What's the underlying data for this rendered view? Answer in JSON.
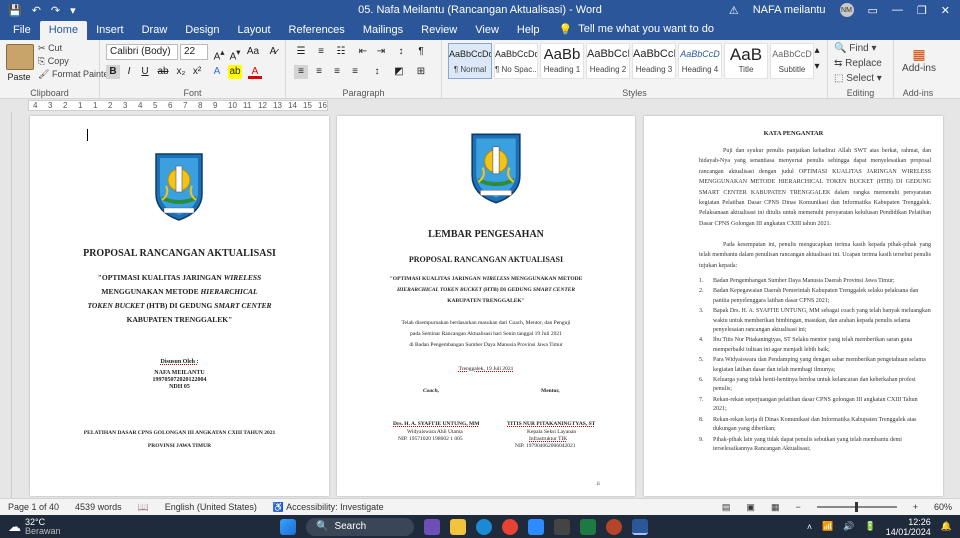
{
  "window": {
    "doc_title": "05. Nafa Meilantu (Rancangan Aktualisasi)  -  Word",
    "user_name": "NAFA meilantu",
    "user_initials": "NM",
    "autosave_icon": "save-icon"
  },
  "menu": {
    "tabs": [
      "File",
      "Home",
      "Insert",
      "Draw",
      "Design",
      "Layout",
      "References",
      "Mailings",
      "Review",
      "View",
      "Help"
    ],
    "active": "Home",
    "tell_me": "Tell me what you want to do"
  },
  "ribbon": {
    "clipboard": {
      "paste": "Paste",
      "cut": "Cut",
      "copy": "Copy",
      "format_painter": "Format Painter",
      "label": "Clipboard"
    },
    "font": {
      "name": "Calibri (Body)",
      "size": "22",
      "label": "Font"
    },
    "paragraph": {
      "label": "Paragraph"
    },
    "styles": {
      "items": [
        {
          "sample": "AaBbCcDd",
          "name": "¶ Normal"
        },
        {
          "sample": "AaBbCcDd",
          "name": "¶ No Spac..."
        },
        {
          "sample": "AaBb",
          "name": "Heading 1"
        },
        {
          "sample": "AaBbCcI",
          "name": "Heading 2"
        },
        {
          "sample": "AaBbCcI",
          "name": "Heading 3"
        },
        {
          "sample": "AaBbCcD",
          "name": "Heading 4"
        },
        {
          "sample": "AaB",
          "name": "Title"
        },
        {
          "sample": "AaBbCcD",
          "name": "Subtitle"
        }
      ],
      "label": "Styles"
    },
    "editing": {
      "find": "Find",
      "replace": "Replace",
      "select": "Select",
      "label": "Editing"
    },
    "addins": {
      "label": "Add-ins",
      "button": "Add-ins"
    }
  },
  "ruler": {
    "ticks": [
      "4",
      "3",
      "2",
      "1",
      "1",
      "2",
      "3",
      "4",
      "5",
      "6",
      "7",
      "8",
      "9",
      "10",
      "11",
      "12",
      "13",
      "14",
      "15",
      "16"
    ]
  },
  "page1": {
    "title": "PROPOSAL RANCANGAN AKTUALISASI",
    "l1a": "\"OPTIMASI KUALITAS JARINGAN ",
    "l1b": "WIRELESS",
    "l2a": "MENGGUNAKAN METODE ",
    "l2b": "HIERARCHICAL",
    "l3a": "TOKEN BUCKET",
    "l3b": " (HTB) DI GEDUNG ",
    "l3c": "SMART CENTER",
    "l4": "KABUPATEN TRENGGALEK\"",
    "by": "Disusun Oleh :",
    "name": "NAFA MEILANTU",
    "nip": "199705072020122004",
    "ndh": "NDH 05",
    "footer1": "PELATIHAN DASAR CPNS GOLONGAN III ANGKATAN CXIII TAHUN 2021",
    "footer2": "PROVINSI JAWA TIMUR"
  },
  "page2": {
    "title": "LEMBAR PENGESAHAN",
    "subtitle": "PROPOSAL RANCANGAN AKTUALISASI",
    "t1a": "\"OPTIMASI KUALITAS JARINGAN ",
    "t1b": "WIRELESS",
    "t1c": " MENGGUNAKAN METODE",
    "t2a": "HIERARCHICAL TOKEN BUCKET",
    "t2b": " (HTB) DI GEDUNG ",
    "t2c": "SMART CENTER",
    "t3": "KABUPATEN TRENGGALEK\"",
    "p1": "Telah disempurnakan berdasarkan masukan dari Coach, Mentor, dan Penguji",
    "p2": "pada Seminar Rancangan Aktualisasi hari Senin tanggal 19 Juli 2021",
    "p3": "di Badan Pengembangan Sumber Daya Manusia Provinsi Jawa Timur",
    "place_date": "Trenggalek, 19 Juli 2021",
    "coach": "Coach,",
    "mentor": "Mentor,",
    "coach_name": "Drs. H. A. SYAFI'IE UNTUNG, MM",
    "coach_rank": "Widyaiswara Ahli Utama",
    "coach_nip": "NIP. 19571020 198002 1 005",
    "mentor_name": "TITIS NUR PITAKANINGTYAS, ST",
    "mentor_rank": "Kepala Seksi Layanan",
    "mentor_rank2": "Infrastruktur TIK",
    "mentor_nip": "NIP. 197904062006042021",
    "page_no": "ii"
  },
  "page3": {
    "title": "KATA PENGANTAR",
    "para1": "Puji dan syukur penulis panjatkan kehadirat Allah SWT atas berkat, rahmat, dan hidayah-Nya yang senantiasa menyertai penulis sehingga dapat menyelesaikan proposal rancangan aktualisasi dengan judul OPTIMASI KUALITAS JARINGAN WIRELESS MENGGUNAKAN METODE HIERARCHICAL TOKEN BUCKET (HTB) DI GEDUNG SMART CENTER KABUPATEN TRENGGALEK dalam rangka memenuhi persyaratan kegiatan Pelatihan Dasar CPNS Dinas Komunikasi dan Informatika Kabupaten Trenggalek. Pelaksanaan aktualisasi ini ditulis untuk memenuhi persyaratan kelulusan Pendidikan Pelatihan Dasar CPNS Golongan III angkatan CXIII tahun 2021.",
    "para2": "Pada kesempatan ini, penulis mengucapkan terima kasih kepada pihak-pihak yang telah membantu dalam penulisan rancangan aktualisasi ini. Ucapan terima kasih tersebut penulis tujukan kepada:",
    "items": [
      "Badan Pengembangan Sumber Daya Manusia Daerah Provinsi Jawa Timur;",
      "Badan Kepegawaian Daerah Pemerintah Kabupaten Trenggalek selaku pelaksana dan panitia penyelenggara latihan dasar CPNS 2021;",
      "Bapak Drs. H. A. SYAFI'IE UNTUNG, MM sebagai coach yang telah banyak meluangkan waktu untuk memberikan bimbingan, masukan, dan arahan kepada penulis selama penyelesaian rancangan aktualisasi ini;",
      "Ibu Titis Nur Pitakaningtyas, ST Selaku mentor yang telah memberikan saran guna memperbaiki tulisan ini agar menjadi lebih baik;",
      "Para Widyaiswara dan Pendamping yang dengan sabar memberikan pengetahuan selama kegiatan latihan dasar dan telah membagi ilmunya;",
      "Keluarga yang tidak henti-hentinya berdoa untuk kelancaran dan keberkahan profesi penulis;",
      "Rekan-rekan seperjuangan pelatihan dasar CPNS golongan III angkatan CXIII Tahun 2021;",
      "Rekan-rekan kerja di Dinas Komunikasi dan Informatika Kabupaten Trenggalek atas dukungan yang diberikan;",
      "Pihak-pihak lain yang tidak dapat penulis sebutkan yang telah membantu demi terselesaikannya Rancangan Aktualisasi;"
    ]
  },
  "status": {
    "page": "Page 1 of 40",
    "words": "4539 words",
    "lang": "English (United States)",
    "accessibility": "Accessibility: Investigate",
    "zoom": "60%"
  },
  "taskbar": {
    "temp": "32°C",
    "weather": "Berawan",
    "search": "Search",
    "time": "12:26",
    "date": "14/01/2024"
  }
}
